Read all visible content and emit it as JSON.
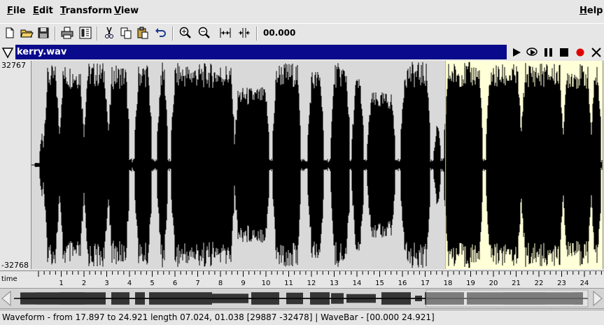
{
  "menubar": {
    "items": [
      {
        "label": "File",
        "mnemonic": "F",
        "rest": "ile"
      },
      {
        "label": "Edit",
        "mnemonic": "E",
        "rest": "dit"
      },
      {
        "label": "Transform",
        "mnemonic": "T",
        "rest": "ransform"
      },
      {
        "label": "View",
        "mnemonic": "V",
        "rest": "iew"
      },
      {
        "label": "Help",
        "mnemonic": "H",
        "rest": "elp"
      }
    ]
  },
  "toolbar": {
    "icons": [
      "new-file-icon",
      "open-folder-icon",
      "save-icon",
      "print-icon",
      "properties-icon",
      "cut-icon",
      "copy-icon",
      "paste-icon",
      "undo-icon",
      "zoom-in-icon",
      "zoom-out-icon",
      "zoom-fit-icon",
      "zoom-selection-icon"
    ],
    "time_readout": "00.000"
  },
  "document": {
    "filename": "kerry.wav",
    "controls": [
      "play-icon",
      "loop-play-icon",
      "pause-icon",
      "stop-icon",
      "record-icon",
      "close-icon"
    ],
    "record_color": "#e00000"
  },
  "waveform": {
    "y_max_label": "32767",
    "y_min_label": "-32768",
    "selection_color": "#ffffd8",
    "background_color": "#d9d9d9",
    "selection_start": 17.897,
    "selection_end": 24.921,
    "total_length": 24.921
  },
  "time_axis": {
    "label": "time",
    "ticks": [
      "1",
      "2",
      "3",
      "4",
      "5",
      "6",
      "7",
      "8",
      "9",
      "10",
      "11",
      "12",
      "13",
      "14",
      "15",
      "16",
      "17",
      "18",
      "19",
      "20",
      "21",
      "22",
      "23",
      "24"
    ]
  },
  "status": {
    "text": "Waveform - from 17.897 to 24.921 length 07.024, 01.038 [29887 -32478] | WaveBar - [00.000 24.921]"
  }
}
